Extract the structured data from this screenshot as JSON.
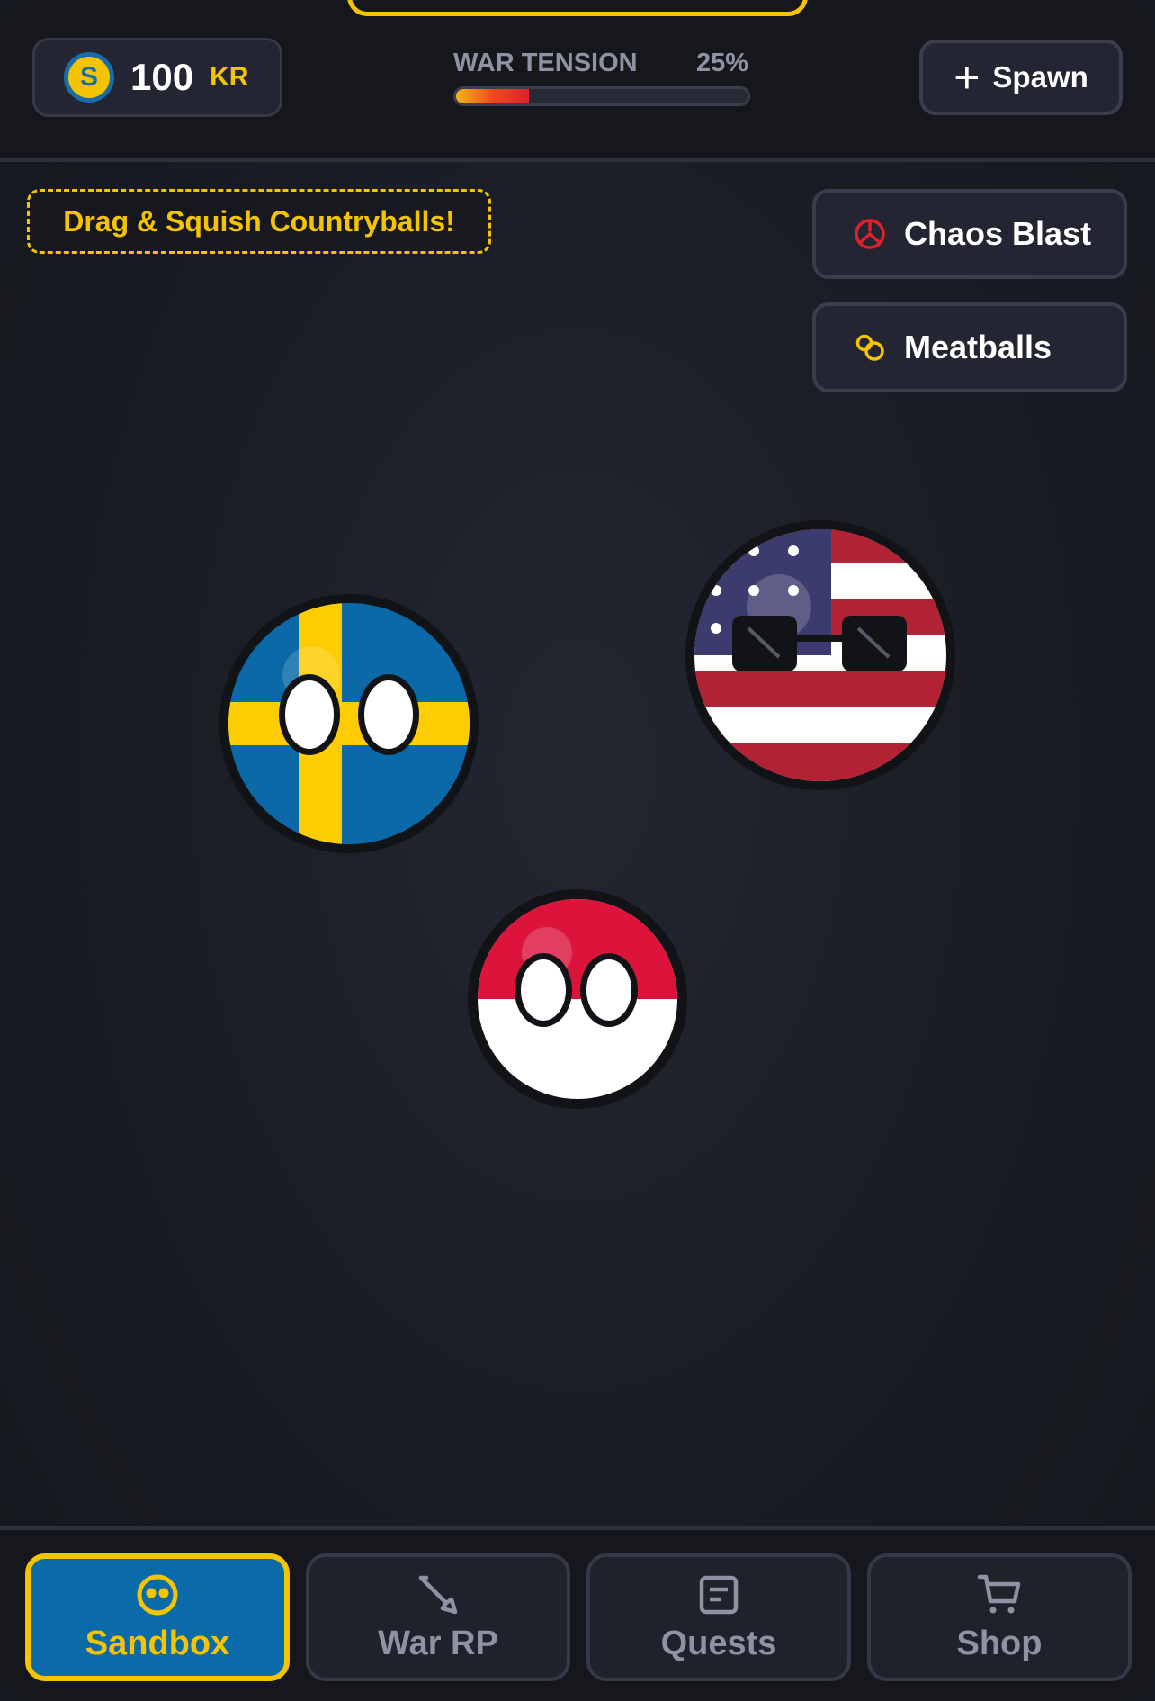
{
  "header": {
    "currency": {
      "amount": "100",
      "unit": "KR",
      "coin_symbol": "S"
    },
    "war_tension": {
      "label": "WAR TENSION",
      "percent_text": "25%",
      "value": 25
    },
    "spawn_label": "Spawn"
  },
  "hint_text": "Drag & Squish Countryballs!",
  "actions": [
    {
      "label": "Chaos Blast",
      "icon": "chaos-icon"
    },
    {
      "label": "Meatballs",
      "icon": "meatballs-icon"
    }
  ],
  "countryballs": [
    {
      "name": "sweden"
    },
    {
      "name": "usa",
      "accessory": "sunglasses"
    },
    {
      "name": "indonesia"
    }
  ],
  "tabs": [
    {
      "label": "Sandbox",
      "icon": "sandbox-icon",
      "active": true
    },
    {
      "label": "War RP",
      "icon": "sword-icon",
      "active": false
    },
    {
      "label": "Quests",
      "icon": "quests-icon",
      "active": false
    },
    {
      "label": "Shop",
      "icon": "cart-icon",
      "active": false
    }
  ],
  "colors": {
    "accent": "#f5c400",
    "active_tab": "#0b6aa8",
    "danger": "#e0202a"
  }
}
